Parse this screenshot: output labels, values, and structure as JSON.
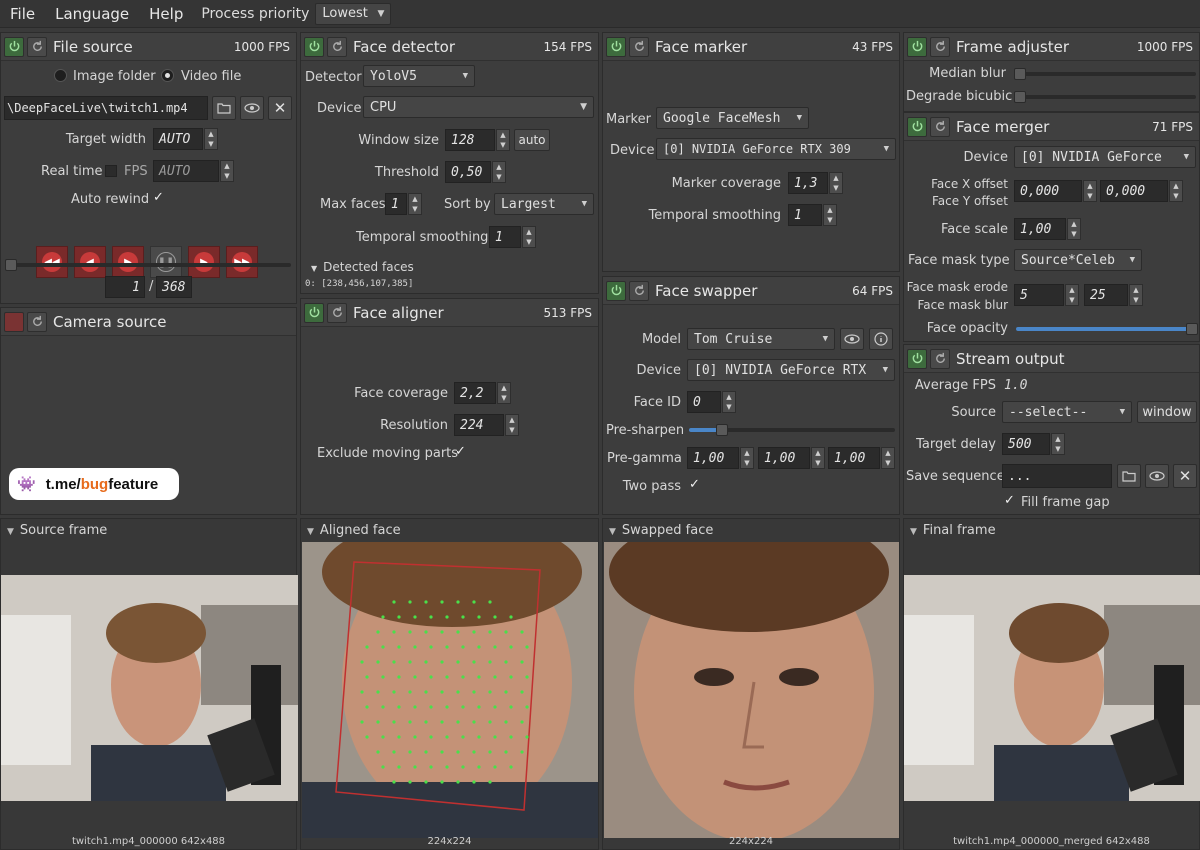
{
  "menu": {
    "file": "File",
    "language": "Language",
    "help": "Help",
    "priority_label": "Process priority",
    "priority_value": "Lowest"
  },
  "file_source": {
    "title": "File source",
    "fps": "1000 FPS",
    "image_folder": "Image folder",
    "video_file": "Video file",
    "path": "\\DeepFaceLive\\twitch1.mp4",
    "target_width_label": "Target width",
    "target_width_value": "AUTO",
    "real_time_label": "Real time",
    "fps_label": "FPS",
    "fps_value": "AUTO",
    "auto_rewind_label": "Auto rewind",
    "frame_current": "1",
    "frame_total": "368",
    "progress": 0.0
  },
  "camera_source": {
    "title": "Camera source"
  },
  "face_detector": {
    "title": "Face detector",
    "fps": "154 FPS",
    "detector_label": "Detector",
    "detector_value": "YoloV5",
    "device_label": "Device",
    "device_value": "CPU",
    "window_size_label": "Window size",
    "window_size_value": "128",
    "auto_label": "auto",
    "threshold_label": "Threshold",
    "threshold_value": "0,50",
    "max_faces_label": "Max faces",
    "max_faces_value": "1",
    "sort_by_label": "Sort by",
    "sort_by_value": "Largest",
    "temporal_label": "Temporal smoothing",
    "temporal_value": "1",
    "detected_label": "Detected faces",
    "detected_value": "0: [238,456,107,385]"
  },
  "face_aligner": {
    "title": "Face aligner",
    "fps": "513 FPS",
    "coverage_label": "Face coverage",
    "coverage_value": "2,2",
    "resolution_label": "Resolution",
    "resolution_value": "224",
    "exclude_label": "Exclude moving parts"
  },
  "face_marker": {
    "title": "Face marker",
    "fps": "43 FPS",
    "marker_label": "Marker",
    "marker_value": "Google FaceMesh",
    "device_label": "Device",
    "device_value": "[0] NVIDIA GeForce RTX 309",
    "coverage_label": "Marker coverage",
    "coverage_value": "1,3",
    "temporal_label": "Temporal smoothing",
    "temporal_value": "1"
  },
  "face_swapper": {
    "title": "Face swapper",
    "fps": "64 FPS",
    "model_label": "Model",
    "model_value": "Tom Cruise",
    "device_label": "Device",
    "device_value": "[0] NVIDIA GeForce RTX",
    "face_id_label": "Face ID",
    "face_id_value": "0",
    "presharpen_label": "Pre-sharpen",
    "pregamma_label": "Pre-gamma",
    "pregamma_r": "1,00",
    "pregamma_g": "1,00",
    "pregamma_b": "1,00",
    "two_pass_label": "Two pass",
    "presharpen_level": 0.16
  },
  "frame_adjuster": {
    "title": "Frame adjuster",
    "fps": "1000 FPS",
    "median_blur_label": "Median blur",
    "degrade_label": "Degrade bicubic"
  },
  "face_merger": {
    "title": "Face merger",
    "fps": "71 FPS",
    "device_label": "Device",
    "device_value": "[0] NVIDIA GeForce",
    "x_offset_label": "Face X offset",
    "y_offset_label": "Face Y offset",
    "x_offset_value": "0,000",
    "y_offset_value": "0,000",
    "scale_label": "Face scale",
    "scale_value": "1,00",
    "mask_type_label": "Face mask type",
    "mask_type_value": "Source*Celeb",
    "erode_label": "Face mask erode",
    "blur_label": "Face mask blur",
    "erode_value": "5",
    "blur_value": "25",
    "opacity_label": "Face opacity",
    "opacity_level": 1.0
  },
  "stream_output": {
    "title": "Stream output",
    "avg_fps_label": "Average FPS",
    "avg_fps_value": "1.0",
    "source_label": "Source",
    "source_value": "--select--",
    "window_label": "window",
    "delay_label": "Target delay",
    "delay_value": "500",
    "save_seq_label": "Save sequence",
    "save_seq_value": "...",
    "fill_gap_label": "Fill frame gap"
  },
  "viewers": {
    "source_title": "Source frame",
    "source_caption": "twitch1.mp4_000000 642x488",
    "aligned_title": "Aligned face",
    "aligned_caption": "224x224",
    "swapped_title": "Swapped face",
    "swapped_caption": "224x224",
    "final_title": "Final frame",
    "final_caption": "twitch1.mp4_000000_merged 642x488"
  },
  "badge": {
    "prefix": "t.me/",
    "bug": "bug",
    "suffix": "feature"
  },
  "colors": {
    "power_on": "#3d6b3d",
    "power_off": "#7a3333",
    "slider_fill": "#4a86c8",
    "play_red": "#c83a3a"
  }
}
